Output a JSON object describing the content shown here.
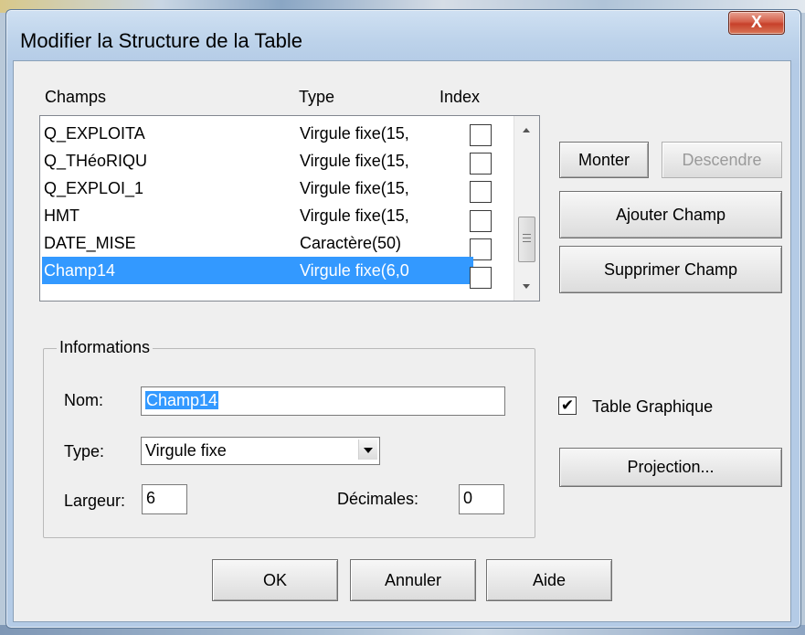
{
  "window": {
    "title": "Modifier la Structure de la Table",
    "close_glyph": "X"
  },
  "columns": {
    "champs": "Champs",
    "type": "Type",
    "index": "Index"
  },
  "fields": [
    {
      "name": "Q_EXPLOITA",
      "type": "Virgule fixe(15,",
      "index": false,
      "selected": false
    },
    {
      "name": "Q_THéoRIQU",
      "type": "Virgule fixe(15,",
      "index": false,
      "selected": false
    },
    {
      "name": "Q_EXPLOI_1",
      "type": "Virgule fixe(15,",
      "index": false,
      "selected": false
    },
    {
      "name": "HMT",
      "type": "Virgule fixe(15,",
      "index": false,
      "selected": false
    },
    {
      "name": "DATE_MISE",
      "type": "Caractère(50)",
      "index": false,
      "selected": false
    },
    {
      "name": "Champ14",
      "type": "Virgule fixe(6,0",
      "index": false,
      "selected": true
    }
  ],
  "buttons": {
    "monter": "Monter",
    "descendre": "Descendre",
    "ajouter": "Ajouter Champ",
    "supprimer": "Supprimer Champ",
    "projection": "Projection...",
    "ok": "OK",
    "annuler": "Annuler",
    "aide": "Aide"
  },
  "informations": {
    "group_label": "Informations",
    "nom_label": "Nom:",
    "nom_value": "Champ14",
    "type_label": "Type:",
    "type_value": "Virgule fixe",
    "largeur_label": "Largeur:",
    "largeur_value": "6",
    "decimales_label": "Décimales:",
    "decimales_value": "0"
  },
  "table_graphique": {
    "label": "Table Graphique",
    "checked": true,
    "check_glyph": "✔"
  },
  "icons": {
    "close": "close-icon",
    "dropdown": "chevron-down-icon",
    "scroll_up": "scroll-up-icon",
    "scroll_down": "scroll-down-icon"
  },
  "colors": {
    "selection": "#3399ff",
    "close_button": "#c7402a"
  }
}
